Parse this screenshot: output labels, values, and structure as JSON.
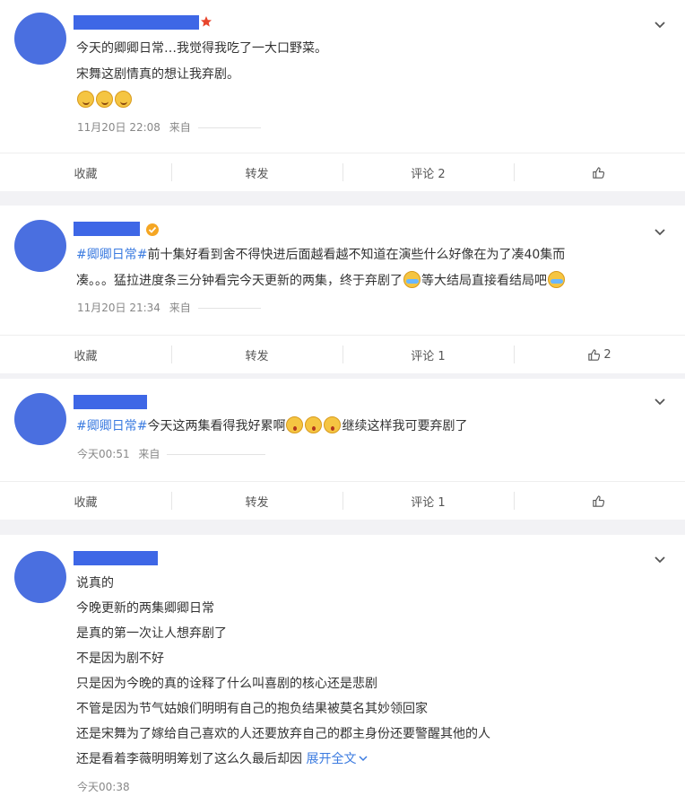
{
  "posts": [
    {
      "text_lines": [
        "今天的卿卿日常…我觉得我吃了一大口野菜。",
        "宋舞这剧情真的想让我弃剧。"
      ],
      "time": "11月20日 22:08",
      "source": "来自",
      "actions": {
        "fav": "收藏",
        "share": "转发",
        "comment": "评论 2",
        "like": ""
      }
    },
    {
      "topic": "#卿卿日常#",
      "text_a": "前十集好看到舍不得快进后面越看越不知道在演些什么好像在为了凑40集而",
      "text_b": "凑。。。猛拉进度条三分钟看完今天更新的两集，终于弃剧了",
      "text_c": "等大结局直接看结局吧",
      "time": "11月20日 21:34",
      "source": "来自",
      "actions": {
        "fav": "收藏",
        "share": "转发",
        "comment": "评论 1",
        "like": "2"
      }
    },
    {
      "topic": "#卿卿日常#",
      "text_a": "今天这两集看得我好累啊",
      "text_b": "继续这样我可要弃剧了",
      "time": "今天00:51",
      "source": "来自",
      "actions": {
        "fav": "收藏",
        "share": "转发",
        "comment": "评论 1",
        "like": ""
      }
    },
    {
      "lines": [
        "说真的",
        "今晚更新的两集卿卿日常",
        "是真的第一次让人想弃剧了",
        "不是因为剧不好",
        "只是因为今晚的真的诠释了什么叫喜剧的核心还是悲剧",
        "不管是因为节气姑娘们明明有自己的抱负结果被莫名其妙领回家",
        "还是宋舞为了嫁给自己喜欢的人还要放弃自己的郡主身份还要警醒其他的人"
      ],
      "last_line": "还是看着李薇明明筹划了这么久最后却因",
      "expand": "展开全文",
      "time": "今天00:38"
    }
  ],
  "icons": {
    "chevron": "chevron-down-icon",
    "like": "thumbs-up-icon",
    "vip": "star-badge-icon",
    "verified": "verified-badge-icon"
  }
}
